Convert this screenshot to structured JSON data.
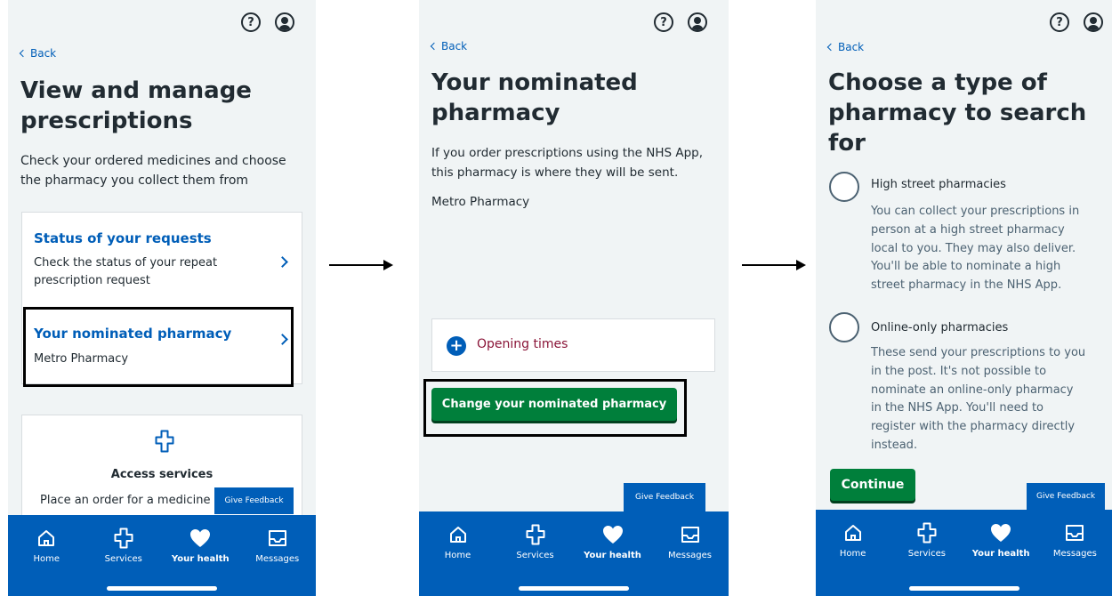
{
  "common": {
    "back_label": "Back",
    "feedback_label": "Give Feedback",
    "nav": [
      {
        "label": "Home",
        "icon": "home-icon"
      },
      {
        "label": "Services",
        "icon": "services-cross-icon"
      },
      {
        "label": "Your health",
        "icon": "heart-icon",
        "active": true
      },
      {
        "label": "Messages",
        "icon": "messages-icon"
      }
    ]
  },
  "screen1": {
    "title_line1": "View and manage",
    "title_line2": "prescriptions",
    "lead_line1": "Check your ordered medicines and choose",
    "lead_line2": "the pharmacy you collect them from",
    "status_link": "Status of your requests",
    "status_desc_line1": "Check the status of your repeat",
    "status_desc_line2": "prescription request",
    "nominated_link": "Your nominated pharmacy",
    "nominated_value": "Metro Pharmacy",
    "access_title": "Access services",
    "access_desc": "Place an order for a medicine"
  },
  "screen2": {
    "title_line1": "Your nominated",
    "title_line2": "pharmacy",
    "lead_line1": "If you order prescriptions using the NHS App,",
    "lead_line2": "this pharmacy is where they will be sent.",
    "pharmacy_name": "Metro Pharmacy",
    "opening_times": "Opening times",
    "change_button": "Change your nominated pharmacy"
  },
  "screen3": {
    "title_line1": "Choose a type of",
    "title_line2": "pharmacy to search",
    "title_line3": "for",
    "option1_label": "High street pharmacies",
    "option1_hint": [
      "You can collect your prescriptions in",
      "person at a high street pharmacy",
      "local to you. They may also deliver.",
      "You'll be able to nominate a high",
      "street pharmacy in the NHS App."
    ],
    "option2_label": "Online-only pharmacies",
    "option2_hint": [
      "These send your prescriptions to you",
      "in the post. It's not possible to",
      "nominate an online-only pharmacy",
      "in the NHS App. You'll need to",
      "register with the pharmacy directly",
      "instead."
    ],
    "continue_button": "Continue"
  },
  "colors": {
    "nhs_blue": "#005eb8",
    "nhs_green": "#007f3b",
    "background": "#f0f4f5",
    "text": "#212b32"
  }
}
